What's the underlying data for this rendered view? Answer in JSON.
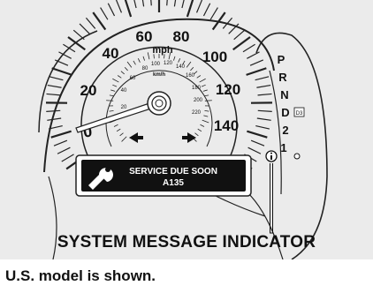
{
  "speedometer": {
    "unit_mph": "mph",
    "unit_kmh": "km/h",
    "mph_labels": [
      "0",
      "20",
      "40",
      "60",
      "80",
      "100",
      "120",
      "140"
    ],
    "kmh_labels": [
      "20",
      "40",
      "60",
      "80",
      "100",
      "120",
      "140",
      "160",
      "180",
      "200",
      "220"
    ]
  },
  "gear_selector": {
    "positions": [
      "P",
      "R",
      "N",
      "D",
      "2",
      "1"
    ],
    "d3_badge": "D3"
  },
  "message_display": {
    "line1": "SERVICE DUE SOON",
    "line2": "A135",
    "icon": "wrench-icon"
  },
  "indicator_icon": "info-icon",
  "callout_label": "SYSTEM MESSAGE INDICATOR",
  "caption": "U.S. model is shown."
}
